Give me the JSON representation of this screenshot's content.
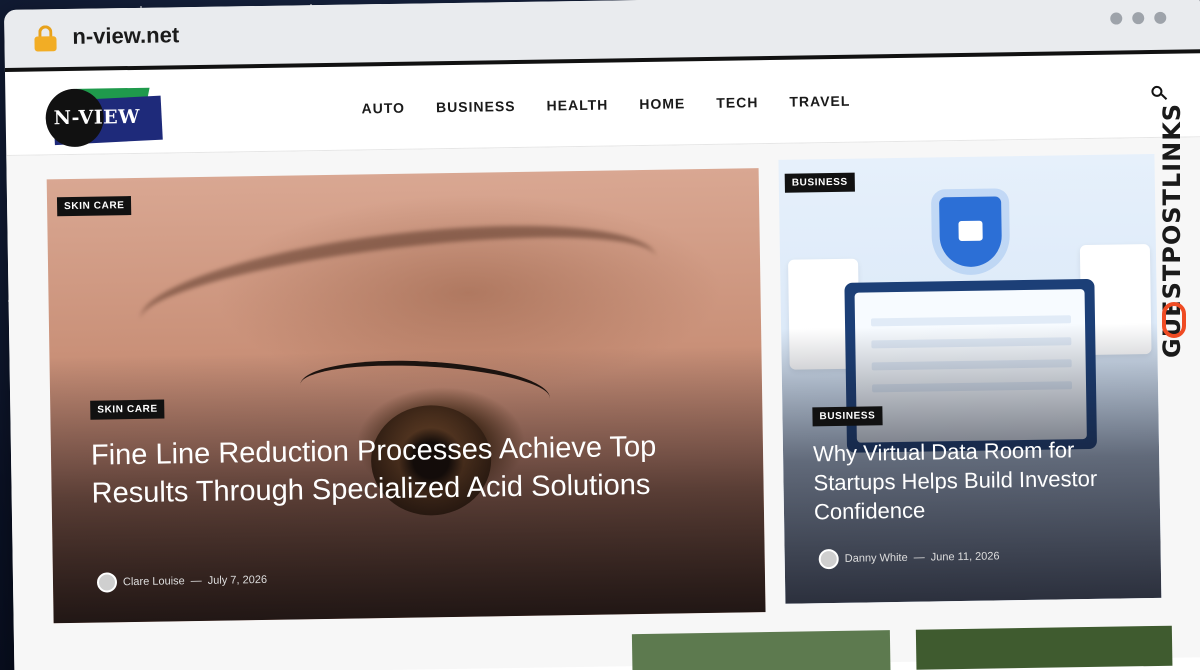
{
  "browser": {
    "url": "n-view.net",
    "lock_icon": "lock-icon"
  },
  "site": {
    "logo_text": "N-VIEW",
    "nav": [
      "AUTO",
      "BUSINESS",
      "HEALTH",
      "HOME",
      "TECH",
      "TRAVEL"
    ],
    "search_icon": "search-icon"
  },
  "hero": {
    "category_top": "SKIN CARE",
    "category": "SKIN CARE",
    "title": "Fine Line Reduction Processes Achieve Top Results Through Specialized Acid Solutions",
    "author": "Clare Louise",
    "separator": "—",
    "date": "July 7, 2026"
  },
  "side_story": {
    "category_top": "BUSINESS",
    "category": "BUSINESS",
    "title": "Why Virtual Data Room for Startups Helps Build Investor Confidence",
    "author": "Danny White",
    "separator": "—",
    "date": "June 11, 2026"
  },
  "watermark": {
    "text": "GUESTPOSTLINKS"
  },
  "colors": {
    "tag_bg": "#111111",
    "lock": "#f2ad25",
    "logo_navy": "#1e2a7a",
    "logo_green": "#1f9a4c",
    "watermark_accent": "#ef4b23"
  }
}
